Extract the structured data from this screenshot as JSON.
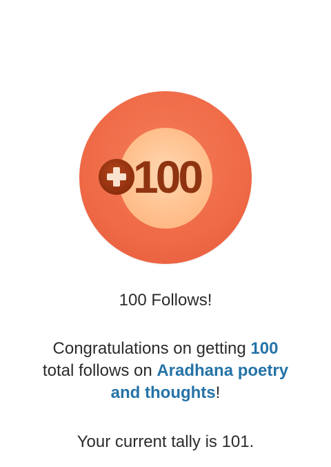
{
  "badge": {
    "icon": "plus-circle-icon",
    "number": "100",
    "colors": {
      "outer": "#ef6a47",
      "inner": "#ffc595",
      "text": "#8f3411"
    }
  },
  "title": "100 Follows!",
  "message": {
    "prefix": "Congratulations on getting ",
    "count": "100",
    "middle": " total follows on ",
    "site_name": "Aradhana poetry and thoughts",
    "suffix": "!"
  },
  "tally": "Your current tally is 101.",
  "colors": {
    "link": "#2573a7",
    "text": "#2b2b2b"
  }
}
